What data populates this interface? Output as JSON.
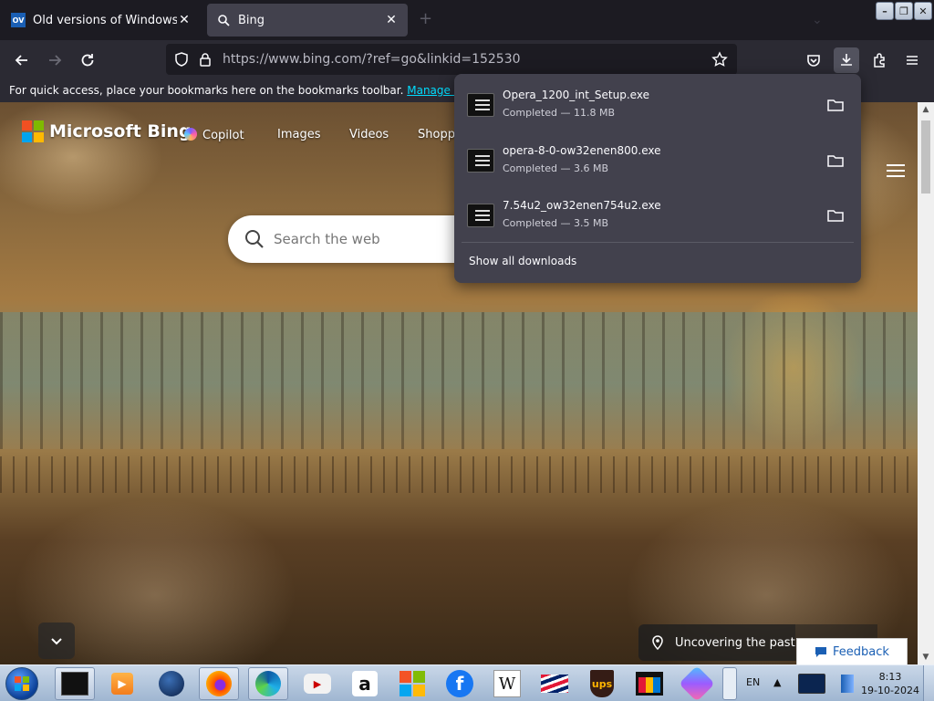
{
  "browser": {
    "tabs": [
      {
        "title": "Old versions of Windows, Mac",
        "favicon": "OV",
        "active": false
      },
      {
        "title": "Bing",
        "favicon": "search-icon",
        "active": true
      }
    ],
    "url": "https://www.bing.com/?ref=go&linkid=152530",
    "bookmarks_bar": {
      "message": "For quick access, place your bookmarks here on the bookmarks toolbar.",
      "link": "Manage bookmarks..."
    },
    "window_controls": [
      "minimize",
      "restore",
      "close"
    ]
  },
  "downloads_panel": {
    "items": [
      {
        "name": "Opera_1200_int_Setup.exe",
        "status": "Completed — 11.8 MB"
      },
      {
        "name": "opera-8-0-ow32enen800.exe",
        "status": "Completed — 3.6 MB"
      },
      {
        "name": "7.54u2_ow32enen754u2.exe",
        "status": "Completed — 3.5 MB"
      }
    ],
    "show_all": "Show all downloads"
  },
  "bing": {
    "brand": "Microsoft Bing",
    "nav": [
      "Copilot",
      "Images",
      "Videos",
      "Shopp"
    ],
    "search_placeholder": "Search the web",
    "caption": "Uncovering the past",
    "feedback": "Feedback"
  },
  "taskbar": {
    "apps": [
      "media-player",
      "explorer",
      "firefox",
      "edge",
      "youtube",
      "amazon",
      "microsoft-store",
      "facebook",
      "wikipedia",
      "bank-of-america",
      "ups",
      "shopping",
      "copilot"
    ],
    "language": "EN",
    "time": "8:13",
    "date": "19-10-2024"
  },
  "colors": {
    "chrome_dark": "#1c1b22",
    "toolbar": "#2b2a33",
    "panel": "#42414d",
    "link_cyan": "#00ddff",
    "feedback_blue": "#1a5fb4"
  }
}
